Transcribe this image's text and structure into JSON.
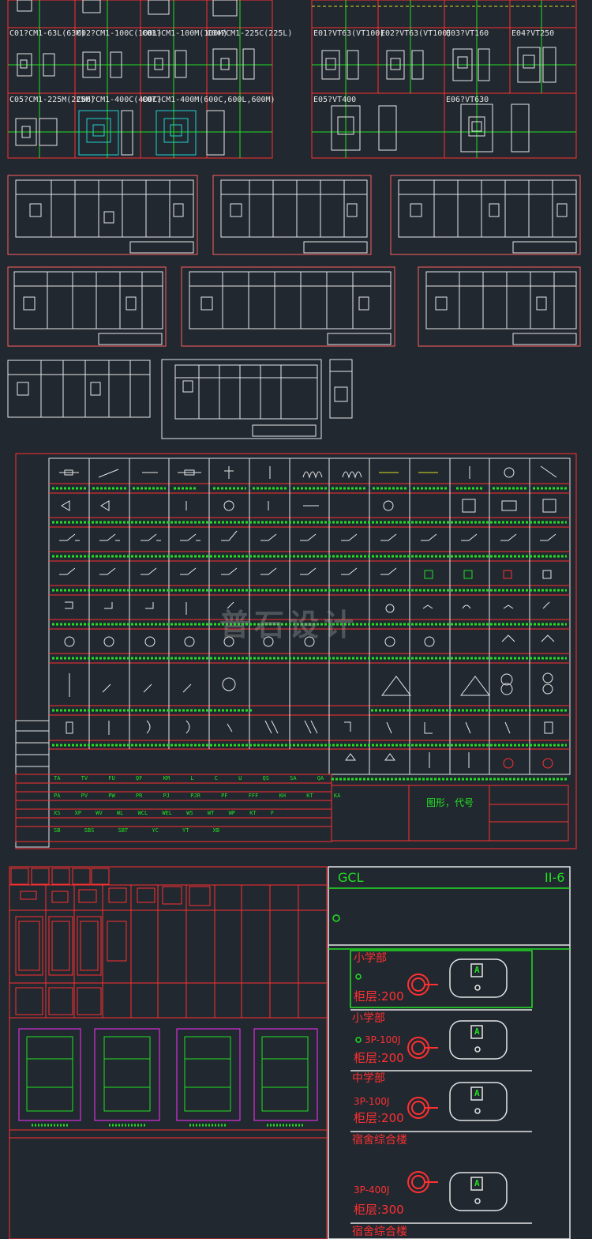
{
  "breaker_labels_left": [
    {
      "id": "c01",
      "text": "C01?CM1-63L(63M)"
    },
    {
      "id": "c02",
      "text": "C02?CM1-100C(100L)"
    },
    {
      "id": "c03",
      "text": "C03?CM1-100M(100M)"
    },
    {
      "id": "c04",
      "text": "C04?CM1-225C(225L)"
    },
    {
      "id": "c05",
      "text": "C05?CM1-225M(225M)"
    },
    {
      "id": "c06",
      "text": "C06?CM1-400C(400C)"
    },
    {
      "id": "c07",
      "text": "C07?CM1-400M(600C,600L,600M)"
    }
  ],
  "breaker_labels_right": [
    {
      "id": "e01",
      "text": "E01?VT63(VT100)"
    },
    {
      "id": "e02",
      "text": "E02?VT63(VT100)"
    },
    {
      "id": "e03",
      "text": "E03?VT160"
    },
    {
      "id": "e04",
      "text": "E04?VT250"
    },
    {
      "id": "e05",
      "text": "E05?VT400"
    },
    {
      "id": "e06",
      "text": "E06?VT630"
    }
  ],
  "watermark": "普石设计",
  "legend": {
    "title": "图形，代号",
    "code_row_1": [
      "TA",
      "TV",
      "FU",
      "QF",
      "KM",
      "L",
      "C",
      "U",
      "QS",
      "SA",
      "QA"
    ],
    "code_row_2": [
      "PA",
      "PV",
      "PW",
      "PR",
      "PJ",
      "PJR",
      "PF",
      "FFF",
      "KH",
      "KT",
      "KA"
    ],
    "code_row_3": [
      "XS",
      "XP",
      "WV",
      "WL",
      "WCL",
      "WEL",
      "WS",
      "WT",
      "WP",
      "KT",
      "F"
    ],
    "code_row_4": [
      "SB",
      "SBS",
      "SBT",
      "YC",
      "YT",
      "XB"
    ]
  },
  "panel": {
    "title": "GCL",
    "code": "II-6",
    "sections": [
      {
        "name": "小学部",
        "spec": "",
        "rating": "柜层:200"
      },
      {
        "name": "小学部",
        "spec": "3P-100J",
        "rating": "柜层:200"
      },
      {
        "name": "中学部",
        "spec": "3P-100J",
        "rating": "柜层:200"
      },
      {
        "name": "宿舍综合楼",
        "spec": "3P-400J",
        "rating": "柜层:300"
      },
      {
        "name": "宿舍综合楼",
        "spec": "",
        "rating": ""
      }
    ],
    "meter_letter": "A"
  },
  "colors": {
    "bg": "#212830",
    "red": "#ff3030",
    "green": "#22e022",
    "white": "#e6e6e6",
    "cyan": "#22d0d0",
    "magenta": "#ff30ff"
  }
}
